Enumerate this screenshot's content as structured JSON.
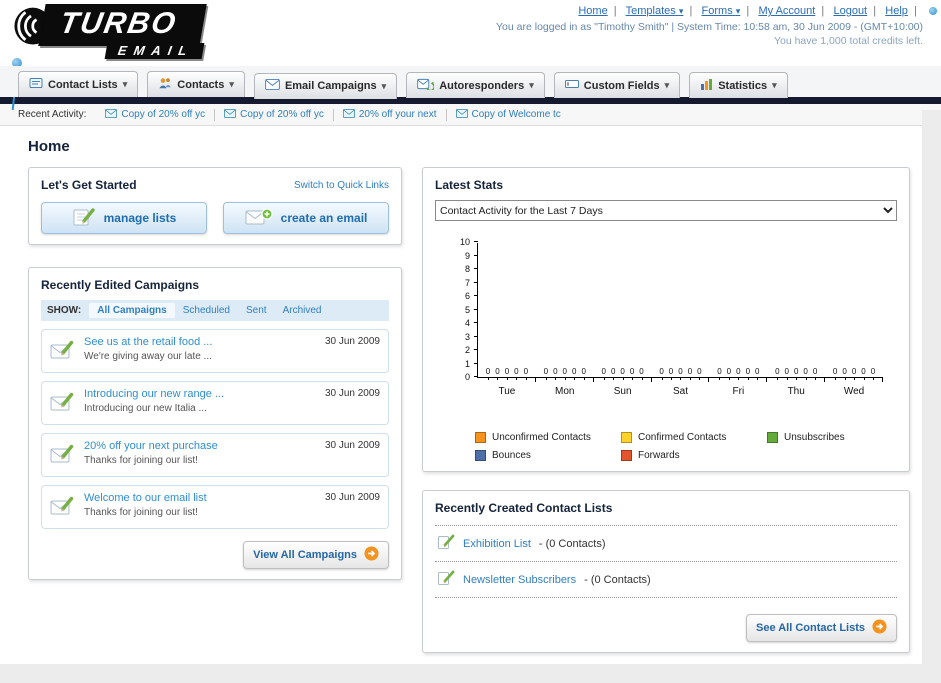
{
  "header": {
    "logo_top": "TURBO",
    "logo_bottom": "EMAIL",
    "nav": [
      {
        "label": "Home",
        "dropdown": false
      },
      {
        "label": "Templates",
        "dropdown": true
      },
      {
        "label": "Forms",
        "dropdown": true
      },
      {
        "label": "My Account",
        "dropdown": false
      },
      {
        "label": "Logout",
        "dropdown": false
      },
      {
        "label": "Help",
        "dropdown": false
      }
    ],
    "login_info": "You are logged in as \"Timothy Smith\" | System Time: 10:58 am, 30 Jun 2009 - (GMT+10:00)",
    "credits": "You have 1,000 total credits left."
  },
  "tabs": [
    {
      "label": "Contact Lists"
    },
    {
      "label": "Contacts"
    },
    {
      "label": "Email Campaigns"
    },
    {
      "label": "Autoresponders"
    },
    {
      "label": "Custom Fields"
    },
    {
      "label": "Statistics"
    }
  ],
  "recent_activity": {
    "label": "Recent Activity:",
    "items": [
      {
        "label": "Copy of 20% off yc"
      },
      {
        "label": "Copy of 20% off yc"
      },
      {
        "label": "20% off your next"
      },
      {
        "label": "Copy of Welcome tc"
      }
    ]
  },
  "page_title": "Home",
  "get_started": {
    "title": "Let's Get Started",
    "switch_link": "Switch to Quick Links",
    "manage_lists_label": "manage lists",
    "create_email_label": "create an email"
  },
  "campaigns": {
    "title": "Recently Edited Campaigns",
    "show_label": "SHOW:",
    "filters": [
      "All Campaigns",
      "Scheduled",
      "Sent",
      "Archived"
    ],
    "active_filter": "All Campaigns",
    "items": [
      {
        "title": "See us at the retail food ...",
        "subtitle": "We're giving away our late ...",
        "date": "30 Jun 2009"
      },
      {
        "title": "Introducing our new range ...",
        "subtitle": "Introducing our new Italia ...",
        "date": "30 Jun 2009"
      },
      {
        "title": "20% off your next purchase",
        "subtitle": "Thanks for joining our list!",
        "date": "30 Jun 2009"
      },
      {
        "title": "Welcome to our email list",
        "subtitle": "Thanks for joining our list!",
        "date": "30 Jun 2009"
      }
    ],
    "view_all_label": "View All Campaigns"
  },
  "stats": {
    "title": "Latest Stats",
    "selector_value": "Contact Activity for the Last 7 Days",
    "chart_data": {
      "type": "bar",
      "categories": [
        "Tue",
        "Mon",
        "Sun",
        "Sat",
        "Fri",
        "Thu",
        "Wed"
      ],
      "series": [
        {
          "name": "Unconfirmed Contacts",
          "color": "#f6921e",
          "values": [
            0,
            0,
            0,
            0,
            0,
            0,
            0
          ]
        },
        {
          "name": "Confirmed Contacts",
          "color": "#ffd12b",
          "values": [
            0,
            0,
            0,
            0,
            0,
            0,
            0
          ]
        },
        {
          "name": "Unsubscribes",
          "color": "#64ab3a",
          "values": [
            0,
            0,
            0,
            0,
            0,
            0,
            0
          ]
        },
        {
          "name": "Bounces",
          "color": "#4d6ea8",
          "values": [
            0,
            0,
            0,
            0,
            0,
            0,
            0
          ]
        },
        {
          "name": "Forwards",
          "color": "#e2552c",
          "values": [
            0,
            0,
            0,
            0,
            0,
            0,
            0
          ]
        }
      ],
      "title": "Contact Activity for the Last 7 Days",
      "xlabel": "",
      "ylabel": "",
      "ylim": [
        0,
        10
      ],
      "grid": false,
      "legend_position": "bottom"
    }
  },
  "contact_lists": {
    "title": "Recently Created Contact Lists",
    "items": [
      {
        "name": "Exhibition List",
        "suffix": "- (0 Contacts)"
      },
      {
        "name": "Newsletter Subscribers",
        "suffix": "- (0 Contacts)"
      }
    ],
    "see_all_label": "See All Contact Lists"
  }
}
